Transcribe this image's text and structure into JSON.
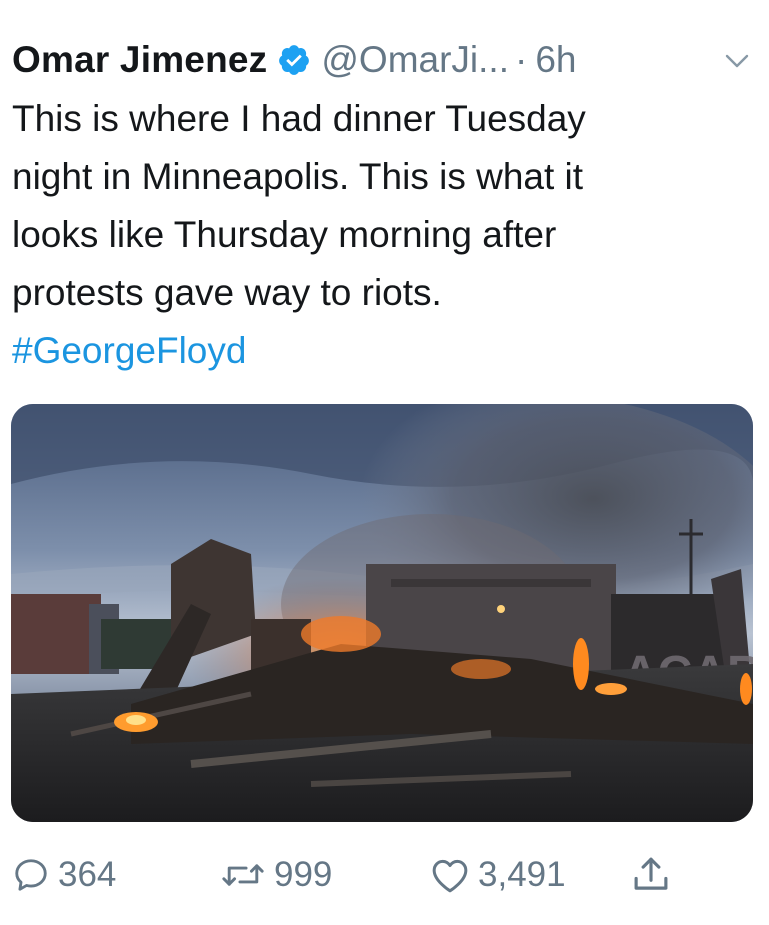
{
  "tweet": {
    "author": {
      "display_name": "Omar Jimenez",
      "handle": "@OmarJi...",
      "verified": true
    },
    "separator": "·",
    "time": "6h",
    "text_lines": [
      "This is where I had dinner Tuesday",
      "night in Minneapolis. This is what it",
      "looks like Thursday morning after",
      "protests gave way to riots."
    ],
    "hashtag": "#GeorgeFloyd",
    "photo": {
      "graffiti_text": "ACAB"
    },
    "stats": {
      "replies": "364",
      "retweets": "999",
      "likes": "3,491"
    },
    "icons": {
      "verified": "verified-badge-icon",
      "caret": "chevron-down-icon",
      "reply": "reply-icon",
      "retweet": "retweet-icon",
      "like": "heart-icon",
      "share": "share-icon"
    },
    "colors": {
      "text": "#14171a",
      "secondary": "#657786",
      "link": "#1b95e0",
      "verified": "#1da1f2"
    }
  }
}
